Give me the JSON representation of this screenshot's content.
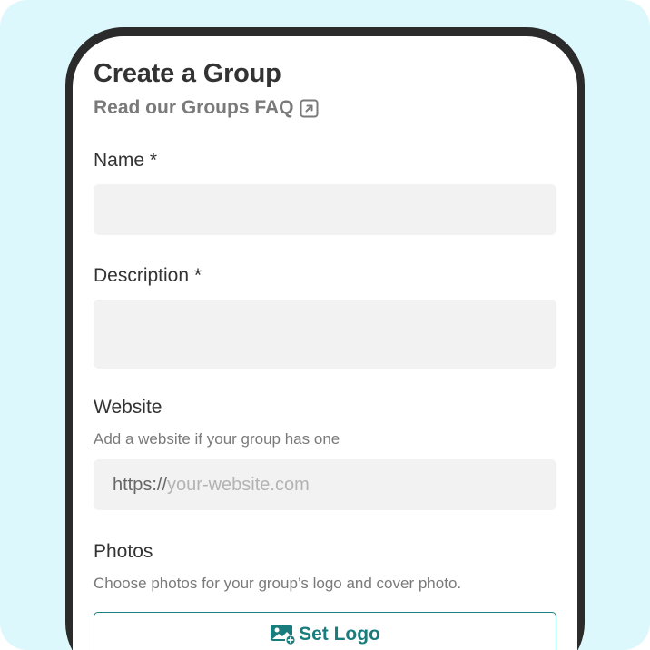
{
  "page": {
    "title": "Create a Group",
    "faq_link": "Read our Groups FAQ",
    "faq_icon": "external-link-icon"
  },
  "fields": {
    "name": {
      "label": "Name *",
      "value": ""
    },
    "description": {
      "label": "Description *",
      "value": ""
    },
    "website": {
      "label": "Website",
      "help": "Add a website if your group has one",
      "prefix": "https://",
      "placeholder": "your-website.com"
    },
    "photos": {
      "label": "Photos",
      "help": "Choose photos for your group’s logo and cover photo.",
      "set_logo_label": "Set Logo",
      "set_logo_icon": "add-image-icon"
    }
  },
  "colors": {
    "background": "#dcf8fc",
    "phone_frame": "#2b2b2b",
    "accent": "#1a7d7d",
    "field_bg": "#f2f2f2"
  }
}
